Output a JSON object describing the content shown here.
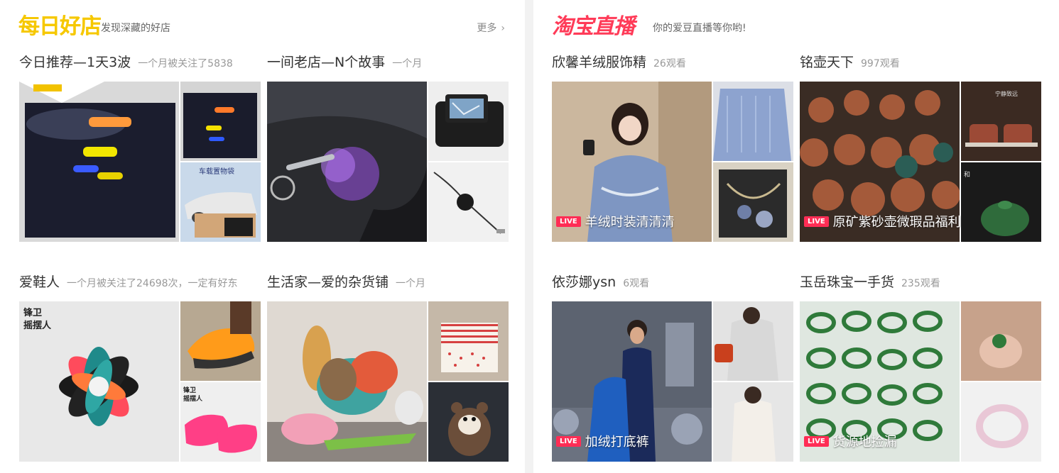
{
  "left": {
    "logo": "每日好店",
    "subtitle": "发现深藏的好店",
    "more": "更多",
    "cards": [
      {
        "name": "今日推荐—1天3波",
        "meta": "一个月被关注了5838",
        "image_text": "",
        "small2_text": "车载置物袋"
      },
      {
        "name": "一间老店—N个故事",
        "meta": "一个月",
        "image_text": "",
        "small2_text": ""
      },
      {
        "name": "爱鞋人",
        "meta": "一个月被关注了24698次，一定有好东",
        "image_text": "锋卫\n摇摆人",
        "small2_text": "锋卫\n摇摆人"
      },
      {
        "name": "生活家—爱的杂货铺",
        "meta": "一个月",
        "image_text": "",
        "small2_text": ""
      }
    ]
  },
  "right": {
    "logo": "淘宝直播",
    "subtitle": "你的爱豆直播等你哟!",
    "cards": [
      {
        "name": "欣馨羊绒服饰精",
        "meta": "26观看",
        "live_badge": "LIVE",
        "live_text": "羊绒时装清清清"
      },
      {
        "name": "铭壶天下",
        "meta": "997观看",
        "live_badge": "LIVE",
        "live_text": "原矿紫砂壶微瑕品福利"
      },
      {
        "name": "依莎娜ysn",
        "meta": "6观看",
        "live_badge": "LIVE",
        "live_text": "加绒打底裤"
      },
      {
        "name": "玉岳珠宝一手货",
        "meta": "235观看",
        "live_badge": "LIVE",
        "live_text": "货源地捡漏"
      }
    ]
  },
  "colors": {
    "logo_yellow": "#f6c800",
    "logo_red": "#ff3b58",
    "live_badge": "#ff2d55"
  }
}
